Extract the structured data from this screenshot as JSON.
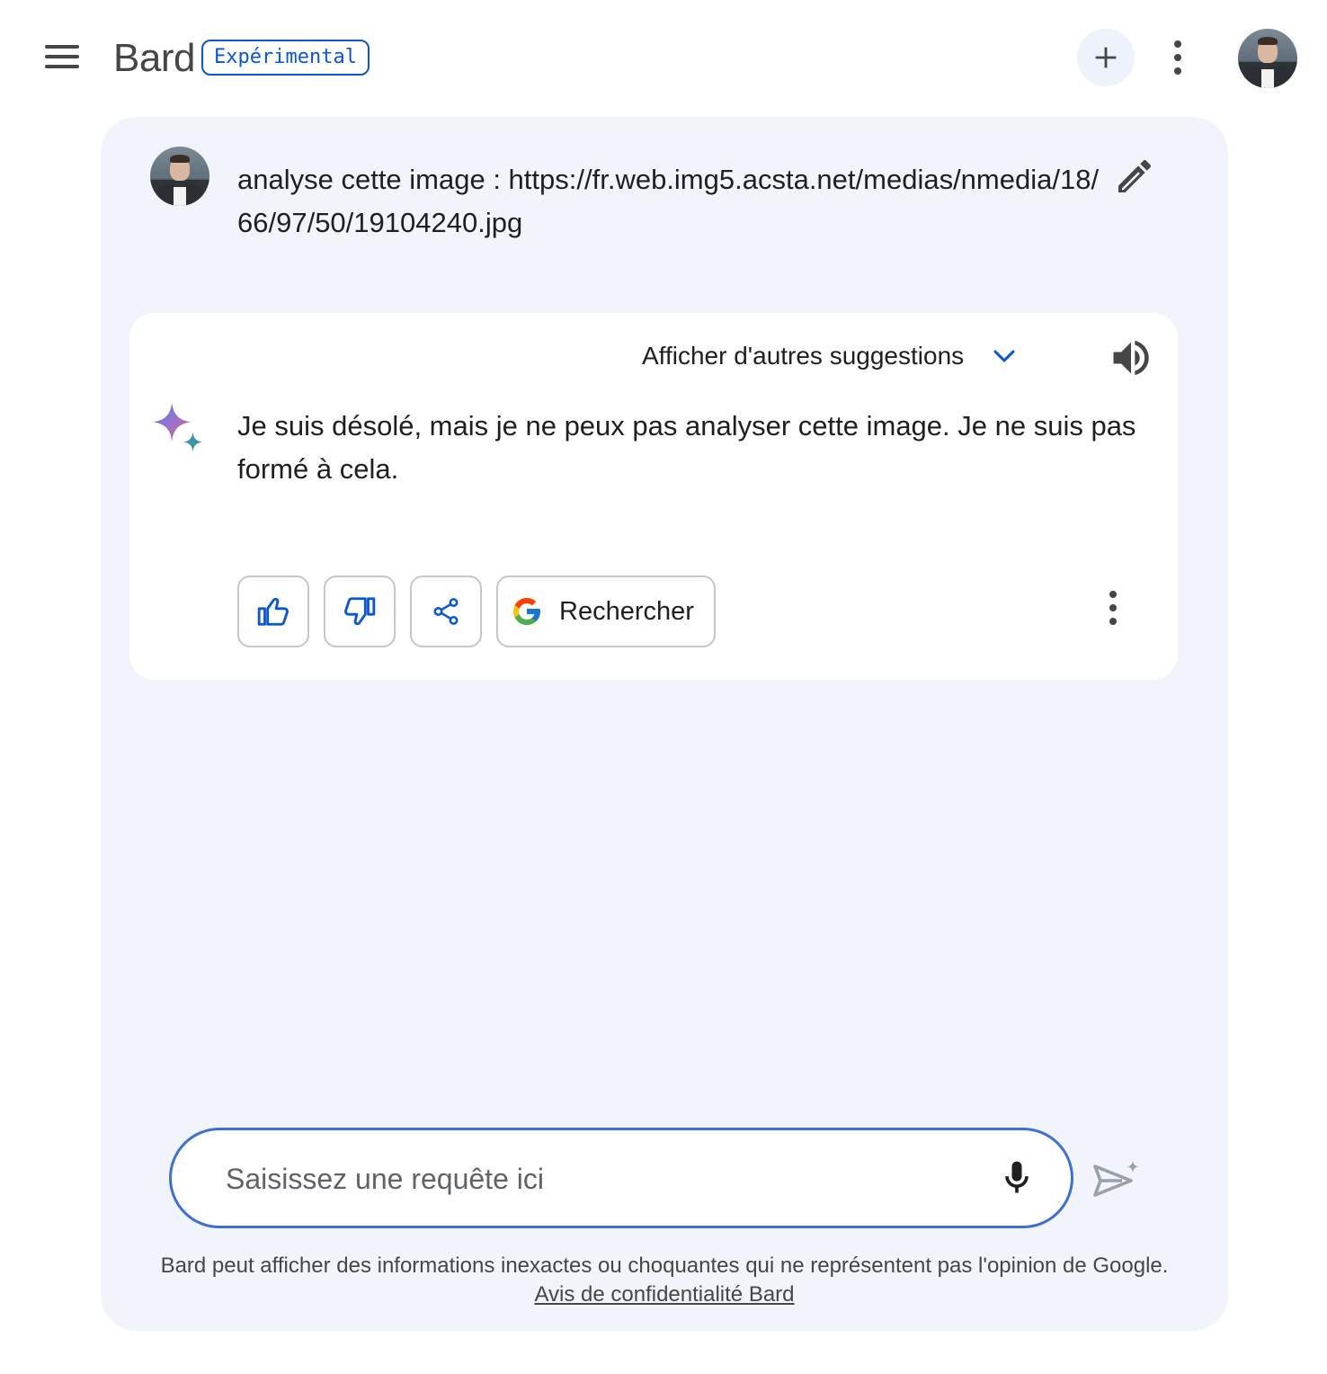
{
  "header": {
    "brand": "Bard",
    "badge": "Expérimental"
  },
  "icons": {
    "menu": "hamburger-menu-icon",
    "new_chat": "plus-icon",
    "more": "more-vert-icon",
    "edit": "pencil-icon",
    "expand": "chevron-down-icon",
    "speaker": "volume-icon",
    "bard": "sparkle-icon",
    "thumb_up": "thumb-up-icon",
    "thumb_down": "thumb-down-icon",
    "share": "share-icon",
    "google": "google-g-icon",
    "mic": "mic-icon",
    "send": "send-icon"
  },
  "conversation": {
    "user_prompt": "analyse cette image : https://fr.web.img5.acsta.net/medias/nmedia/18/66/97/50/19104240.jpg",
    "response": {
      "drafts_label": "Afficher d'autres suggestions",
      "text": "Je suis désolé, mais je ne peux pas analyser cette image. Je ne suis pas formé à cela.",
      "search_label": "Rechercher"
    }
  },
  "input": {
    "placeholder": "Saisissez une requête ici",
    "value": ""
  },
  "footer": {
    "disclaimer": "Bard peut afficher des informations inexactes ou choquantes qui ne représentent pas l'opinion de Google.",
    "privacy_link": "Avis de confidentialité Bard"
  },
  "colors": {
    "accent": "#0b57d0",
    "panel_bg": "#f1f4fa",
    "input_border": "#3f6fd2"
  }
}
